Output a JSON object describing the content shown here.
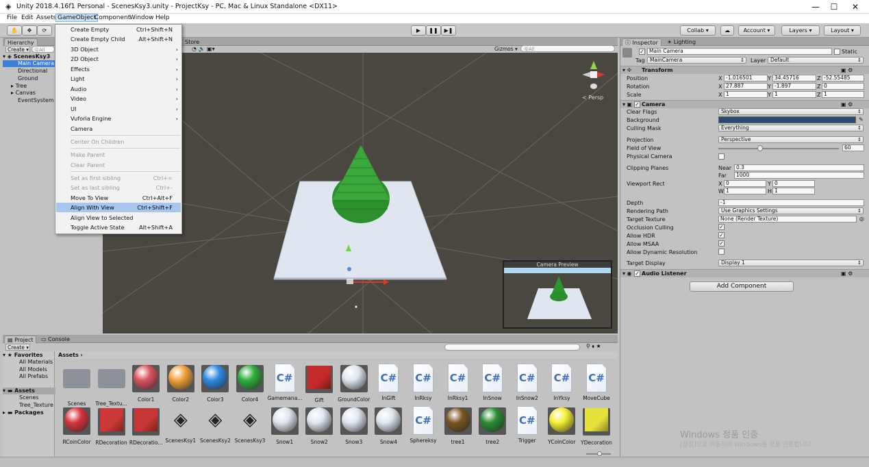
{
  "window": {
    "title": "Unity 2018.4.16f1 Personal - ScenesKsy3.unity - ProjectKsy - PC, Mac & Linux Standalone <DX11>"
  },
  "menubar": [
    "File",
    "Edit",
    "Assets",
    "GameObject",
    "Component",
    "Window",
    "Help"
  ],
  "toolbar": {
    "collab": "Collab",
    "account": "Account",
    "layers": "Layers",
    "layout": "Layout"
  },
  "gameobject_menu": [
    {
      "label": "Create Empty",
      "shortcut": "Ctrl+Shift+N",
      "disabled": false
    },
    {
      "label": "Create Empty Child",
      "shortcut": "Alt+Shift+N",
      "disabled": false
    },
    {
      "label": "3D Object",
      "arrow": true
    },
    {
      "label": "2D Object",
      "arrow": true
    },
    {
      "label": "Effects",
      "arrow": true
    },
    {
      "label": "Light",
      "arrow": true
    },
    {
      "label": "Audio",
      "arrow": true
    },
    {
      "label": "Video",
      "arrow": true
    },
    {
      "label": "UI",
      "arrow": true
    },
    {
      "label": "Vuforia Engine",
      "arrow": true
    },
    {
      "label": "Camera"
    },
    {
      "label": "Center On Children",
      "disabled": true
    },
    {
      "label": "Make Parent",
      "disabled": true
    },
    {
      "label": "Clear Parent",
      "disabled": true
    },
    {
      "label": "Set as first sibling",
      "shortcut": "Ctrl+=",
      "disabled": true
    },
    {
      "label": "Set as last sibling",
      "shortcut": "Ctrl+-",
      "disabled": true
    },
    {
      "label": "Move To View",
      "shortcut": "Ctrl+Alt+F"
    },
    {
      "label": "Align With View",
      "shortcut": "Ctrl+Shift+F",
      "highlighted": true
    },
    {
      "label": "Align View to Selected"
    },
    {
      "label": "Toggle Active State",
      "shortcut": "Alt+Shift+A"
    }
  ],
  "hierarchy": {
    "tab": "Hierarchy",
    "create": "Create",
    "search": "ⓆAll",
    "scene": "ScenesKsy3",
    "items": [
      "Main Camera",
      "Directional",
      "Ground",
      "Tree",
      "Canvas",
      "EventSystem"
    ]
  },
  "scene": {
    "store_tab": "Store",
    "gizmos": "Gizmos",
    "search": "ⓆAll",
    "persp": "< Persp",
    "preview_title": "Camera Preview"
  },
  "inspector": {
    "tab": "Inspector",
    "lighting_tab": "Lighting",
    "name": "Main Camera",
    "static": "Static",
    "tag_label": "Tag",
    "tag": "MainCamera",
    "layer_label": "Layer",
    "layer": "Default",
    "transform": {
      "title": "Transform",
      "position_label": "Position",
      "rotation_label": "Rotation",
      "scale_label": "Scale",
      "position": [
        "-1.016501",
        "34.45716",
        "-52.55485"
      ],
      "rotation": [
        "27.887",
        "-1.897",
        "0"
      ],
      "scale": [
        "1",
        "1",
        "1"
      ]
    },
    "camera": {
      "title": "Camera",
      "clear_flags_label": "Clear Flags",
      "clear_flags": "Skybox",
      "background_label": "Background",
      "background_color": "#2b4a72",
      "culling_label": "Culling Mask",
      "culling": "Everything",
      "projection_label": "Projection",
      "projection": "Perspective",
      "fov_label": "Field of View",
      "fov": "60",
      "physical_label": "Physical Camera",
      "clipping_label": "Clipping Planes",
      "near_label": "Near",
      "near": "0.3",
      "far_label": "Far",
      "far": "1000",
      "viewport_label": "Viewport Rect",
      "vx": "0",
      "vy": "0",
      "vw": "1",
      "vh": "1",
      "depth_label": "Depth",
      "depth": "-1",
      "rendering_label": "Rendering Path",
      "rendering": "Use Graphics Settings",
      "target_label": "Target Texture",
      "target": "None (Render Texture)",
      "occlusion_label": "Occlusion Culling",
      "hdr_label": "Allow HDR",
      "msaa_label": "Allow MSAA",
      "dynres_label": "Allow Dynamic Resolution",
      "display_label": "Target Display",
      "display": "Display 1"
    },
    "audio": {
      "title": "Audio Listener"
    },
    "add_component": "Add Component"
  },
  "project": {
    "tab": "Project",
    "console_tab": "Console",
    "create": "Create",
    "breadcrumb": "Assets",
    "favorites": {
      "title": "Favorites",
      "items": [
        "All Materials",
        "All Models",
        "All Prefabs"
      ]
    },
    "tree": {
      "assets": "Assets",
      "items": [
        "Scenes",
        "Tree_Texture"
      ],
      "packages": "Packages"
    },
    "assets": [
      {
        "name": "Scenes",
        "kind": "folder"
      },
      {
        "name": "Tree_Textu...",
        "kind": "folder"
      },
      {
        "name": "Color1",
        "kind": "sphere",
        "color": "#d9545e"
      },
      {
        "name": "Color2",
        "kind": "sphere",
        "color": "#f0a23a"
      },
      {
        "name": "Color3",
        "kind": "sphere",
        "color": "#2f8ae0"
      },
      {
        "name": "Color4",
        "kind": "sphere",
        "color": "#2eae3c"
      },
      {
        "name": "Gamemana...",
        "kind": "script"
      },
      {
        "name": "Gift",
        "kind": "cube",
        "color": "#c42a2a"
      },
      {
        "name": "GroundColor",
        "kind": "sphere",
        "color": "#dfe6f0"
      },
      {
        "name": "InGift",
        "kind": "script"
      },
      {
        "name": "InRksy",
        "kind": "script"
      },
      {
        "name": "InRksy1",
        "kind": "script"
      },
      {
        "name": "InSnow",
        "kind": "script"
      },
      {
        "name": "InSnow2",
        "kind": "script"
      },
      {
        "name": "InYksy",
        "kind": "script"
      },
      {
        "name": "MoveCube",
        "kind": "script"
      },
      {
        "name": "RCoinColor",
        "kind": "sphere",
        "color": "#d8343e"
      },
      {
        "name": "RDecoration",
        "kind": "cube",
        "color": "#cc3838"
      },
      {
        "name": "RDecoratio...",
        "kind": "cube",
        "color": "#c83636"
      },
      {
        "name": "ScenesKsy1",
        "kind": "unity"
      },
      {
        "name": "ScenesKsy2",
        "kind": "unity"
      },
      {
        "name": "ScenesKsy3",
        "kind": "unity"
      },
      {
        "name": "Snow1",
        "kind": "sphere",
        "color": "#dfe6f0"
      },
      {
        "name": "Snow2",
        "kind": "sphere",
        "color": "#dfe6f0"
      },
      {
        "name": "Snow3",
        "kind": "sphere",
        "color": "#dfe6f0"
      },
      {
        "name": "Snow4",
        "kind": "sphere",
        "color": "#dfe6f0"
      },
      {
        "name": "Sphereksy",
        "kind": "script"
      },
      {
        "name": "tree1",
        "kind": "sphere",
        "color": "#7a5520"
      },
      {
        "name": "tree2",
        "kind": "sphere",
        "color": "#2a8c32"
      },
      {
        "name": "Trigger",
        "kind": "script"
      },
      {
        "name": "YCoinColor",
        "kind": "sphere",
        "color": "#f4f032"
      },
      {
        "name": "YDecoration",
        "kind": "cube",
        "color": "#e6e03a"
      }
    ]
  },
  "watermark": {
    "line1": "Windows 정품 인증",
    "line2": "[설정]으로 이동하여 Windows를 정품 인증합니다."
  }
}
